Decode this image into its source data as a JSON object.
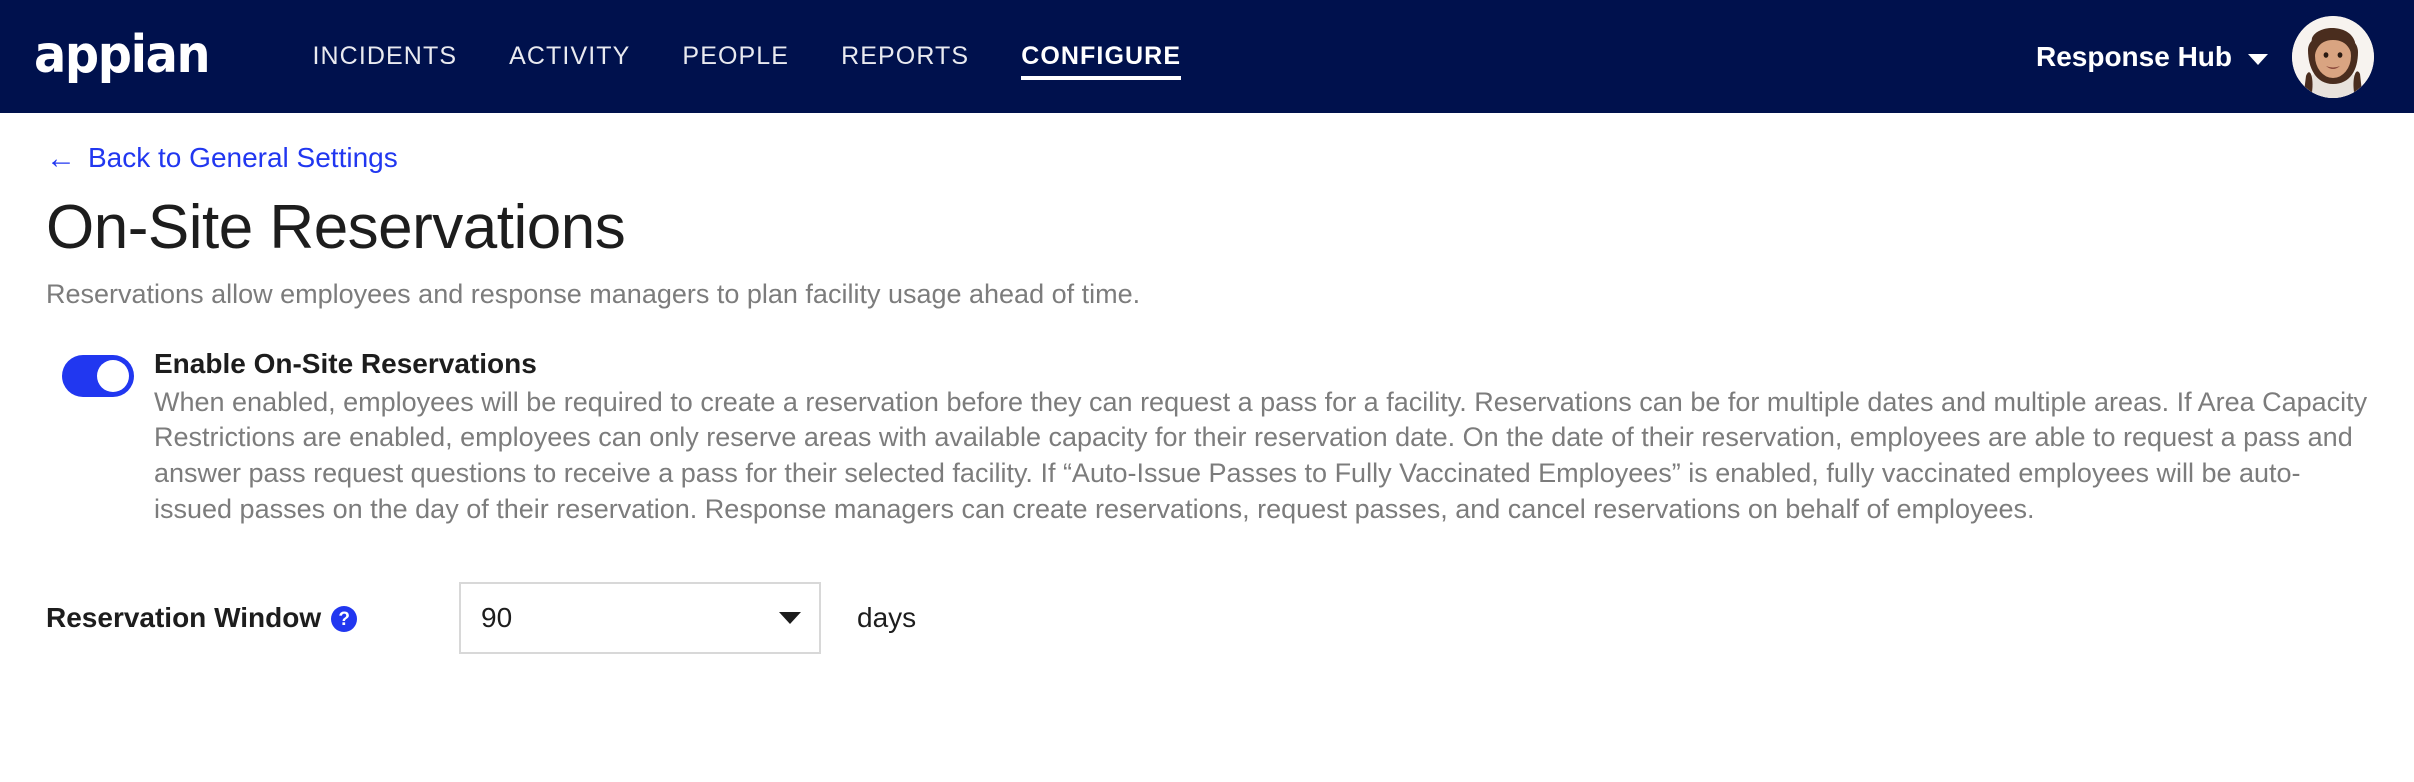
{
  "header": {
    "brand": "appian",
    "nav": [
      {
        "label": "INCIDENTS",
        "active": false
      },
      {
        "label": "ACTIVITY",
        "active": false
      },
      {
        "label": "PEOPLE",
        "active": false
      },
      {
        "label": "REPORTS",
        "active": false
      },
      {
        "label": "CONFIGURE",
        "active": true
      }
    ],
    "account": {
      "label": "Response Hub",
      "caret_icon": "chevron-down-icon",
      "avatar_icon": "user-avatar-photo"
    },
    "background_color": "#00114d"
  },
  "page": {
    "back_link": {
      "arrow_icon": "arrow-left-icon",
      "label": "Back to General Settings",
      "color": "#2137f0"
    },
    "title": "On-Site Reservations",
    "subtitle": "Reservations allow employees and response managers to plan facility usage ahead of time."
  },
  "enable_setting": {
    "toggle_state": "on",
    "toggle_color": "#2137f0",
    "label": "Enable On-Site Reservations",
    "description": "When enabled, employees will be required to create a reservation before they can request a pass for a facility. Reservations can be for multiple dates and multiple areas. If Area Capacity Restrictions are enabled, employees can only reserve areas with available capacity for their reservation date. On the date of their reservation, employees are able to request a pass and answer pass request questions to receive a pass for their selected facility. If “Auto-Issue Passes to Fully Vaccinated Employees” is enabled, fully vaccinated employees will be auto-issued passes on the day of their reservation. Response managers can create reservations, request passes, and cancel reservations on behalf of employees."
  },
  "reservation_window": {
    "label": "Reservation Window",
    "help_icon": "help-question-icon",
    "help_icon_glyph": "?",
    "selected_value": "90",
    "caret_icon": "caret-down-icon",
    "unit": "days"
  }
}
